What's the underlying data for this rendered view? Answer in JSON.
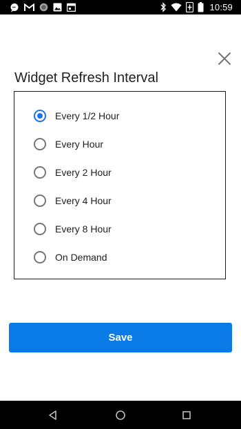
{
  "status_bar": {
    "time": "10:59",
    "left_icons": [
      "chat-bubble-icon",
      "gmail-icon",
      "circle-app-icon",
      "image-icon",
      "calendar-icon"
    ],
    "right_icons": [
      "bluetooth-icon",
      "wifi-icon",
      "battery-saver-icon",
      "battery-icon"
    ]
  },
  "dialog": {
    "title": "Widget Refresh Interval",
    "close_icon": "close-icon",
    "options": [
      {
        "label": "Every 1/2 Hour",
        "checked": true
      },
      {
        "label": "Every Hour",
        "checked": false
      },
      {
        "label": "Every 2 Hour",
        "checked": false
      },
      {
        "label": "Every 4 Hour",
        "checked": false
      },
      {
        "label": "Every 8 Hour",
        "checked": false
      },
      {
        "label": "On Demand",
        "checked": false
      }
    ],
    "save_label": "Save"
  },
  "nav_bar": {
    "icons": [
      "back-icon",
      "home-icon",
      "recents-icon"
    ]
  },
  "colors": {
    "accent": "#1a73e8",
    "save_button": "#0a7ae6",
    "status_bar": "#000000",
    "nav_bar": "#000000"
  }
}
